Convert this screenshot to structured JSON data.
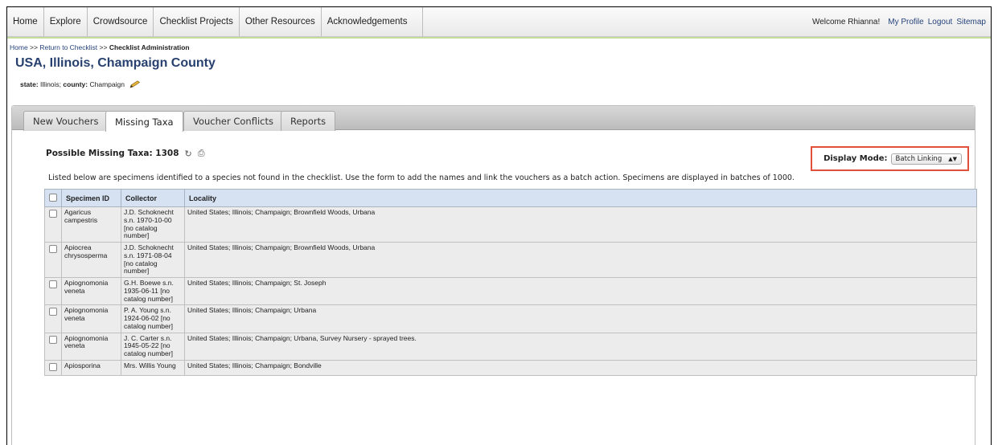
{
  "nav": {
    "items": [
      "Home",
      "Explore",
      "Crowdsource",
      "Checklist Projects",
      "Other Resources",
      "Acknowledgements"
    ],
    "welcome": "Welcome Rhianna!",
    "my_profile": "My Profile",
    "logout": "Logout",
    "sitemap": "Sitemap"
  },
  "breadcrumb": {
    "home": "Home",
    "sep1": " >> ",
    "return": "Return to Checklist",
    "sep2": " >> ",
    "current": "Checklist Administration"
  },
  "page_title": "USA, Illinois, Champaign County",
  "meta": {
    "state_label": "state:",
    "state_value": " Illinois; ",
    "county_label": "county:",
    "county_value": " Champaign"
  },
  "tabs": [
    "New Vouchers",
    "Missing Taxa",
    "Voucher Conflicts",
    "Reports"
  ],
  "missing": {
    "label": "Possible Missing Taxa: 1308",
    "refresh_icon": "↻",
    "print_icon": "⎙"
  },
  "display_mode": {
    "label": "Display Mode:",
    "selected": "Batch Linking"
  },
  "description": "Listed below are specimens identified to a species not found in the checklist. Use the form to add the names and link the vouchers as a batch action. Specimens are displayed in batches of 1000.",
  "table": {
    "headers": [
      "Specimen ID",
      "Collector",
      "Locality"
    ],
    "rows": [
      {
        "specimen": "Agaricus campestris",
        "collector": "J.D. Schoknecht s.n. 1970-10-00 [no catalog number]",
        "locality": "United States; Illinois; Champaign; Brownfield Woods, Urbana"
      },
      {
        "specimen": "Apiocrea chrysosperma",
        "collector": "J.D. Schoknecht s.n. 1971-08-04 [no catalog number]",
        "locality": "United States; Illinois; Champaign; Brownfield Woods, Urbana"
      },
      {
        "specimen": "Apiognomonia veneta",
        "collector": "G.H. Boewe s.n. 1935-06-11 [no catalog number]",
        "locality": "United States; Illinois; Champaign; St. Joseph"
      },
      {
        "specimen": "Apiognomonia veneta",
        "collector": "P. A. Young s.n. 1924-06-02 [no catalog number]",
        "locality": "United States; Illinois; Champaign; Urbana"
      },
      {
        "specimen": "Apiognomonia veneta",
        "collector": "J. C. Carter s.n. 1945-05-22 [no catalog number]",
        "locality": "United States; Illinois; Champaign; Urbana, Survey Nursery - sprayed trees."
      },
      {
        "specimen": "Apiosporina",
        "collector": "Mrs. Willis Young",
        "locality": "United States; Illinois; Champaign; Bondville"
      }
    ]
  }
}
